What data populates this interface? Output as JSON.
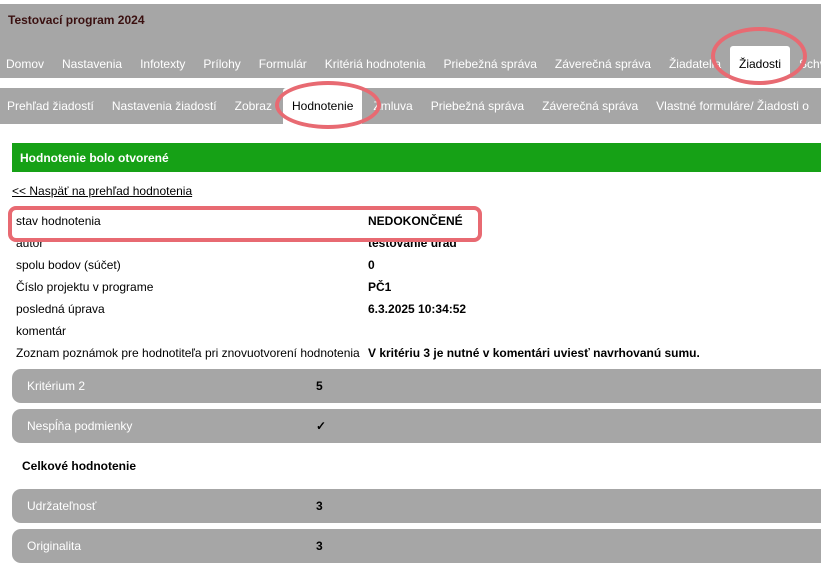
{
  "app": {
    "title": "Testovací program 2024"
  },
  "main_nav": [
    {
      "label": "Domov"
    },
    {
      "label": "Nastavenia"
    },
    {
      "label": "Infotexty"
    },
    {
      "label": "Prílohy"
    },
    {
      "label": "Formulár"
    },
    {
      "label": "Kritériá hodnotenia"
    },
    {
      "label": "Priebežná správa"
    },
    {
      "label": "Záverečná správa"
    },
    {
      "label": "Žiadatelia"
    },
    {
      "label": "Žiadosti"
    },
    {
      "label": "Schv"
    }
  ],
  "sub_nav": [
    {
      "label": "Prehľad žiadostí"
    },
    {
      "label": "Nastavenia žiadostí"
    },
    {
      "label": "Zobraz"
    },
    {
      "label": "Hodnotenie"
    },
    {
      "label": "Zmluva"
    },
    {
      "label": "Priebežná správa"
    },
    {
      "label": "Záverečná správa"
    },
    {
      "label": "Vlastné formuláre/ Žiadosti o"
    }
  ],
  "notice": "Hodnotenie bolo otvorené",
  "back_link": "<< Naspäť na prehľad hodnotenia",
  "info": [
    {
      "label": "stav hodnotenia",
      "value": "NEDOKONČENÉ"
    },
    {
      "label": "autor",
      "value": "testovanie urad"
    },
    {
      "label": "spolu bodov (súčet)",
      "value": "0"
    },
    {
      "label": "Číslo projektu v programe",
      "value": "PČ1"
    },
    {
      "label": "posledná úprava",
      "value": "6.3.2025 10:34:52"
    },
    {
      "label": "komentár",
      "value": ""
    },
    {
      "label": "Zoznam poznámok pre hodnotiteľa pri znovuotvorení hodnotenia",
      "value": "V kritériu 3 je nutné v komentári uviesť navrhovanú sumu."
    }
  ],
  "criteria_top": [
    {
      "name": "Kritérium 2",
      "score": "5"
    },
    {
      "name": "Nespĺňa podmienky",
      "score": "✓"
    }
  ],
  "overall_title": "Celkové hodnotenie",
  "criteria_overall": [
    {
      "name": "Udržateľnosť",
      "score": "3"
    },
    {
      "name": "Originalita",
      "score": "3"
    }
  ],
  "colors": {
    "nav_bg": "#a6a6a6",
    "notice_bg": "#16a116",
    "highlight": "#e86a72"
  }
}
